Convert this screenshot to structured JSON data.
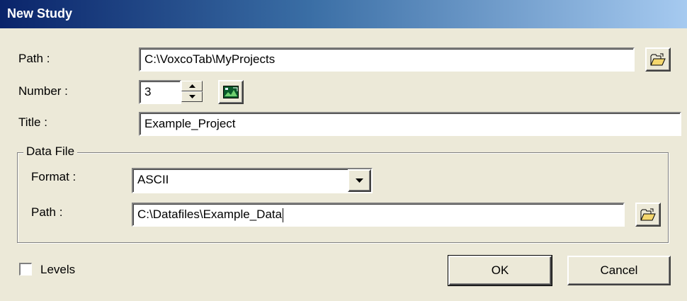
{
  "window": {
    "title": "New Study"
  },
  "study": {
    "path_label": "Path :",
    "path_value": "C:\\VoxcoTab\\MyProjects",
    "number_label": "Number :",
    "number_value": "3",
    "title_label": "Title :",
    "title_value": "Example_Project"
  },
  "data_file": {
    "group_label": "Data File",
    "format_label": "Format :",
    "format_value": "ASCII",
    "path_label": "Path :",
    "path_value": "C:\\Datafiles\\Example_Data"
  },
  "options": {
    "levels_label": "Levels",
    "levels_checked": false
  },
  "buttons": {
    "ok": "OK",
    "cancel": "Cancel"
  },
  "icons": {
    "browse_study_path": "folder-open-icon",
    "number_picker": "image-picker-icon",
    "browse_data_path": "folder-open-icon",
    "dropdown": "triangle-down-icon"
  }
}
